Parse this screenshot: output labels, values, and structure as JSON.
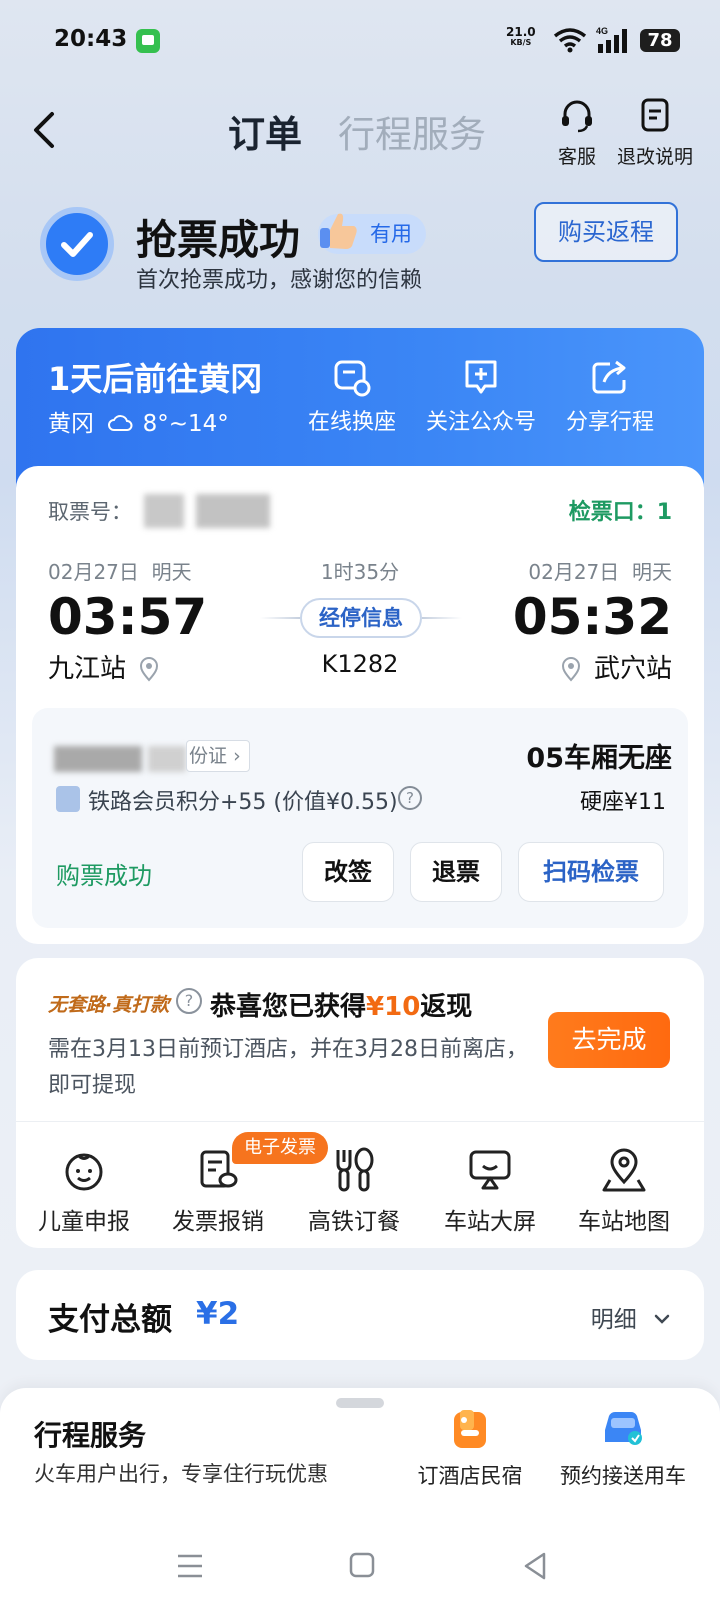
{
  "status_bar": {
    "time": "20:43",
    "net_speed_value": "21.0",
    "net_speed_unit": "KB/S",
    "signal_label": "4G",
    "battery": "78"
  },
  "header": {
    "tabs": [
      {
        "label": "订单",
        "active": true
      },
      {
        "label": "行程服务",
        "active": false
      }
    ],
    "service_label": "客服",
    "refund_rules_label": "退改说明"
  },
  "success": {
    "title": "抢票成功",
    "useful_label": "有用",
    "subtitle": "首次抢票成功，感谢您的信赖",
    "return_button": "购买返程"
  },
  "trip_banner": {
    "title": "1天后前往黄冈",
    "weather_city": "黄冈",
    "weather_temp": "8°~14°",
    "actions": [
      {
        "label": "在线换座",
        "icon": "seat-swap-icon"
      },
      {
        "label": "关注公众号",
        "icon": "follow-plus-icon"
      },
      {
        "label": "分享行程",
        "icon": "share-icon"
      }
    ]
  },
  "ticket": {
    "pickup_label": "取票号：",
    "gate": "检票口：1",
    "depart_date": "02月27日",
    "depart_day": "明天",
    "arrive_date": "02月27日",
    "arrive_day": "明天",
    "duration": "1时35分",
    "depart_time": "03:57",
    "arrive_time": "05:32",
    "stop_info": "经停信息",
    "depart_station": "九江站",
    "arrive_station": "武穴站",
    "train_no": "K1282",
    "id_tag": "份证",
    "coach_seat": "05车厢无座",
    "points": "铁路会员积分+55 (价值¥0.55)",
    "seat_price": "硬座¥11",
    "status": "购票成功",
    "buttons": {
      "change": "改签",
      "refund": "退票",
      "scan": "扫码检票"
    }
  },
  "promo": {
    "tag": "无套路·真打款",
    "title_prefix": "恭喜您已获得",
    "amount": "¥10",
    "title_suffix": "返现",
    "desc": "需在3月13日前预订酒店，并在3月28日前离店，即可提现",
    "go_button": "去完成",
    "einvoice_badge": "电子发票",
    "services": [
      {
        "label": "儿童申报",
        "icon": "child-icon"
      },
      {
        "label": "发票报销",
        "icon": "invoice-icon"
      },
      {
        "label": "高铁订餐",
        "icon": "dining-icon"
      },
      {
        "label": "车站大屏",
        "icon": "station-screen-icon"
      },
      {
        "label": "车站地图",
        "icon": "map-pin-icon"
      }
    ]
  },
  "payment": {
    "label": "支付总额",
    "amount": "¥2",
    "detail": "明细"
  },
  "sheet": {
    "title": "行程服务",
    "subtitle": "火车用户出行，专享住行玩优惠",
    "hotel_label": "订酒店民宿",
    "car_label": "预约接送用车"
  },
  "colors": {
    "accent": "#2f74ef",
    "success_green": "#1e9a62",
    "promo_orange": "#ff6a10"
  }
}
